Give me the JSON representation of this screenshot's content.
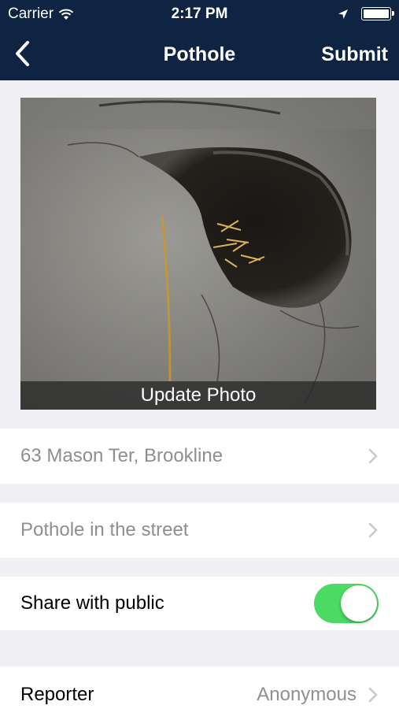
{
  "status_bar": {
    "carrier": "Carrier",
    "time": "2:17 PM",
    "battery_level": 1.0
  },
  "nav": {
    "title": "Pothole",
    "submit_label": "Submit",
    "back_icon": "chevron-left-icon"
  },
  "photo": {
    "update_label": "Update Photo"
  },
  "address": {
    "text": "63 Mason Ter, Brookline"
  },
  "description": {
    "text": "Pothole in the street"
  },
  "share": {
    "label": "Share with public",
    "enabled": true
  },
  "reporter": {
    "label": "Reporter",
    "value": "Anonymous"
  },
  "colors": {
    "nav_bg": "#0e2442",
    "toggle_on": "#4cd964",
    "muted_text": "#8e8e93",
    "background": "#efeff4"
  }
}
